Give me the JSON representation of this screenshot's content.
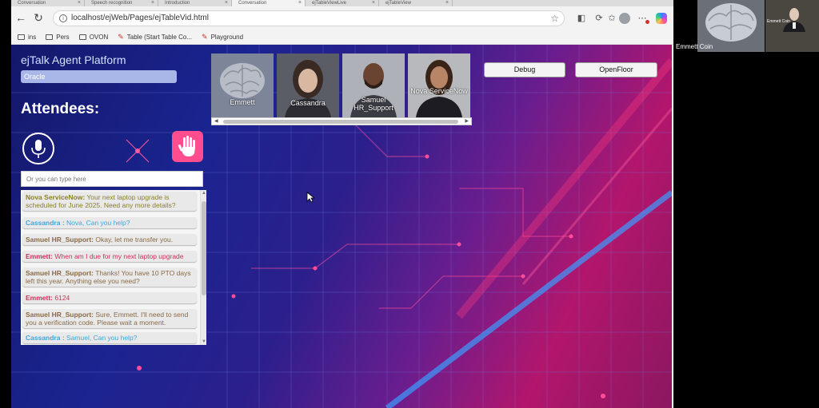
{
  "browser": {
    "address": "localhost/ejWeb/Pages/ejTableVid.html",
    "tabs": [
      {
        "label": "Conversation"
      },
      {
        "label": "Speech recognition"
      },
      {
        "label": "Introduction"
      },
      {
        "label": "Conversation"
      },
      {
        "label": "ejTableViewLive"
      },
      {
        "label": "ejTableView"
      }
    ],
    "bookmarks": [
      {
        "label": "ins",
        "icon": "folder-icon"
      },
      {
        "label": "Pers",
        "icon": "folder-icon"
      },
      {
        "label": "OVON",
        "icon": "folder-icon"
      },
      {
        "label": "Table (Start Table Co...",
        "icon": "bookmark-icon"
      },
      {
        "label": "Playground",
        "icon": "bookmark-icon"
      }
    ]
  },
  "app": {
    "title": "ejTalk Agent Platform",
    "org": "Oracle",
    "attendees_heading": "Attendees:",
    "input_placeholder": "Or you can type here",
    "debug_label": "Debug",
    "openfloor_label": "OpenFloor"
  },
  "avatars": [
    {
      "name": "Emmett",
      "icon": "brain-icon"
    },
    {
      "name": "Cassandra",
      "icon": "person-icon"
    },
    {
      "name": "Samuel HR_Support",
      "icon": "person-icon"
    },
    {
      "name": "Nova ServiceNow",
      "icon": "person-icon"
    }
  ],
  "messages": [
    {
      "speaker": "Nova ServiceNow:",
      "text": " Your next laptop upgrade is scheduled for June 2025. Need any more details?"
    },
    {
      "speaker": "Cassandra :",
      "text": " Nova, Can you help?"
    },
    {
      "speaker": "Samuel HR_Support:",
      "text": " Okay, let me transfer you."
    },
    {
      "speaker": "Emmett:",
      "text": " When am I due for my next laptop upgrade"
    },
    {
      "speaker": "Samuel HR_Support:",
      "text": " Thanks! You have 10 PTO days left this year. Anything else you need?"
    },
    {
      "speaker": "Emmett:",
      "text": " 6124"
    },
    {
      "speaker": "Samuel HR_Support:",
      "text": " Sure, Emmett. I'll need to send you a verification code. Please wait a moment."
    },
    {
      "speaker": "Cassandra :",
      "text": " Samuel, Can you help?"
    }
  ],
  "video": {
    "participant_name": "Emmett Coin",
    "tile2_label": "Emmett Coin"
  },
  "colors": {
    "nova": "#8a8028",
    "cassandra": "#3fa6d8",
    "samuel": "#8a6a45",
    "emmett": "#d12f5a",
    "hand_button": "#ff4d8d"
  }
}
